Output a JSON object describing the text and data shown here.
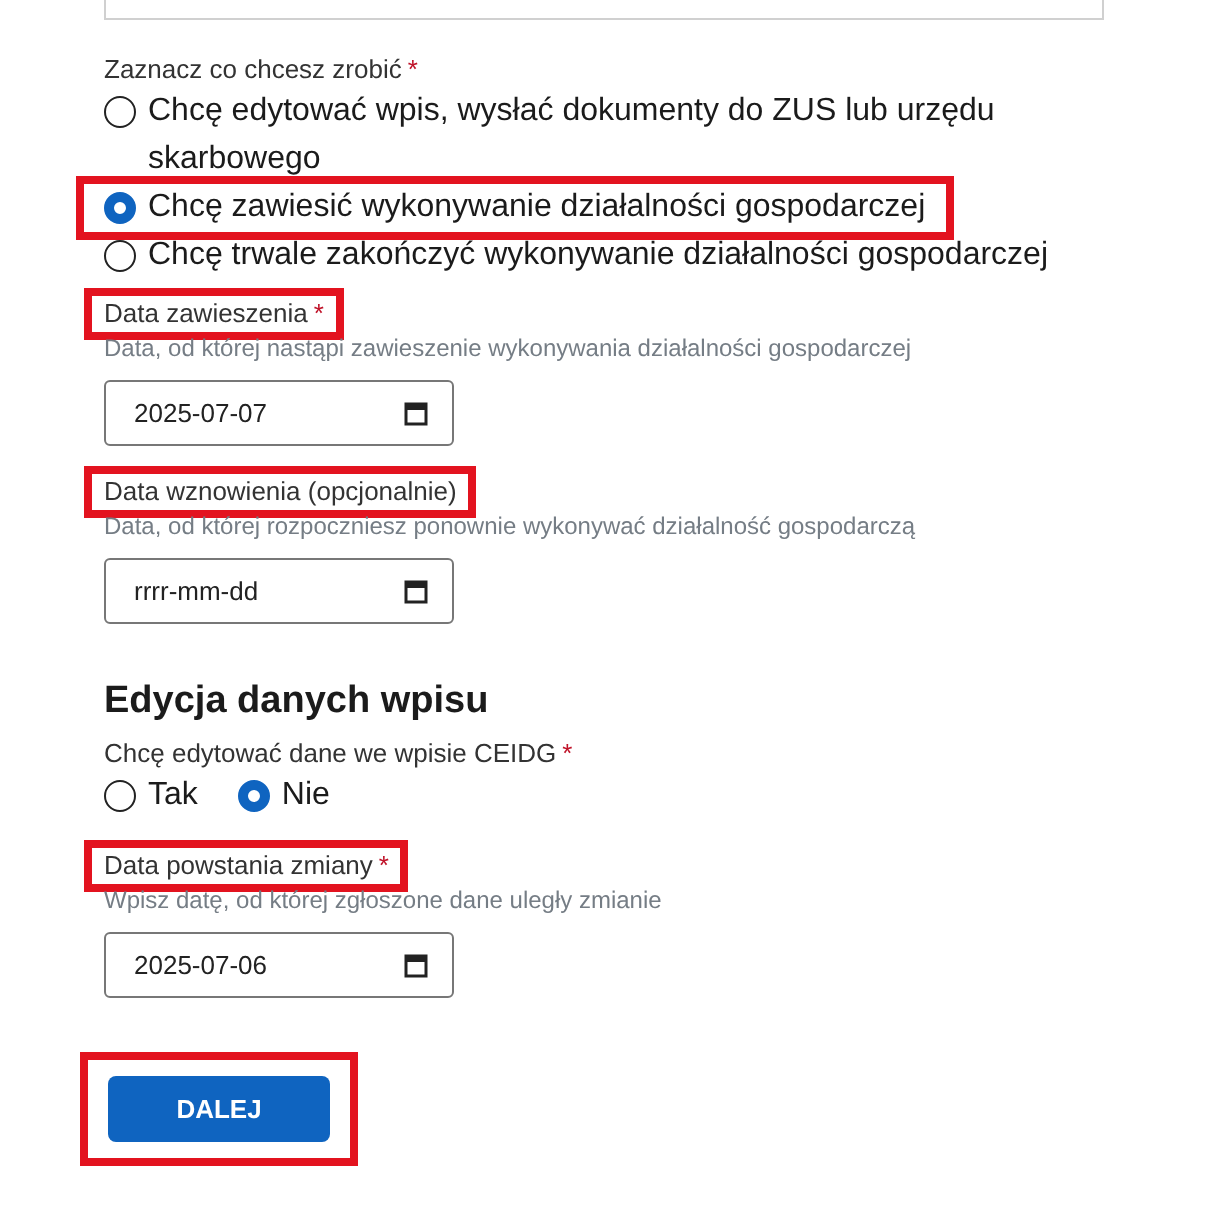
{
  "fields": [
    {
      "kind": "radio_group",
      "inline": false,
      "label": "Zaznacz co chcesz zrobić",
      "required_mark": "*",
      "options": [
        {
          "label": "Chcę edytować wpis, wysłać dokumenty do ZUS lub urzędu skarbowego",
          "selected": false,
          "highlighted": false
        },
        {
          "label": "Chcę zawiesić wykonywanie działalności gospodarczej",
          "selected": true,
          "highlighted": true
        },
        {
          "label": "Chcę trwale zakończyć wykonywanie działalności gospodarczej",
          "selected": false,
          "highlighted": false
        }
      ]
    },
    {
      "kind": "date",
      "label": "Data zawieszenia",
      "required_mark": "*",
      "highlighted": true,
      "hint": "Data, od której nastąpi zawieszenie wykonywania działalności gospodarczej",
      "value": "2025-07-07"
    },
    {
      "kind": "date",
      "label": "Data wznowienia (opcjonalnie)",
      "highlighted": true,
      "hint": "Data, od której rozpoczniesz ponownie wykonywać działalność gospodarczą",
      "placeholder": "rrrr-mm-dd"
    },
    {
      "kind": "heading",
      "text": "Edycja danych wpisu"
    },
    {
      "kind": "radio_group",
      "inline": true,
      "label": "Chcę edytować dane we wpisie CEIDG",
      "required_mark": "*",
      "options": [
        {
          "label": "Tak",
          "selected": false,
          "highlighted": false
        },
        {
          "label": "Nie",
          "selected": true,
          "highlighted": false
        }
      ]
    },
    {
      "kind": "date",
      "label": "Data powstania zmiany",
      "required_mark": "*",
      "highlighted": true,
      "hint": "Wpisz datę, od której zgłoszone dane uległy zmianie",
      "value": "2025-07-06"
    }
  ],
  "button": {
    "label": "DALEJ",
    "highlighted": true
  }
}
